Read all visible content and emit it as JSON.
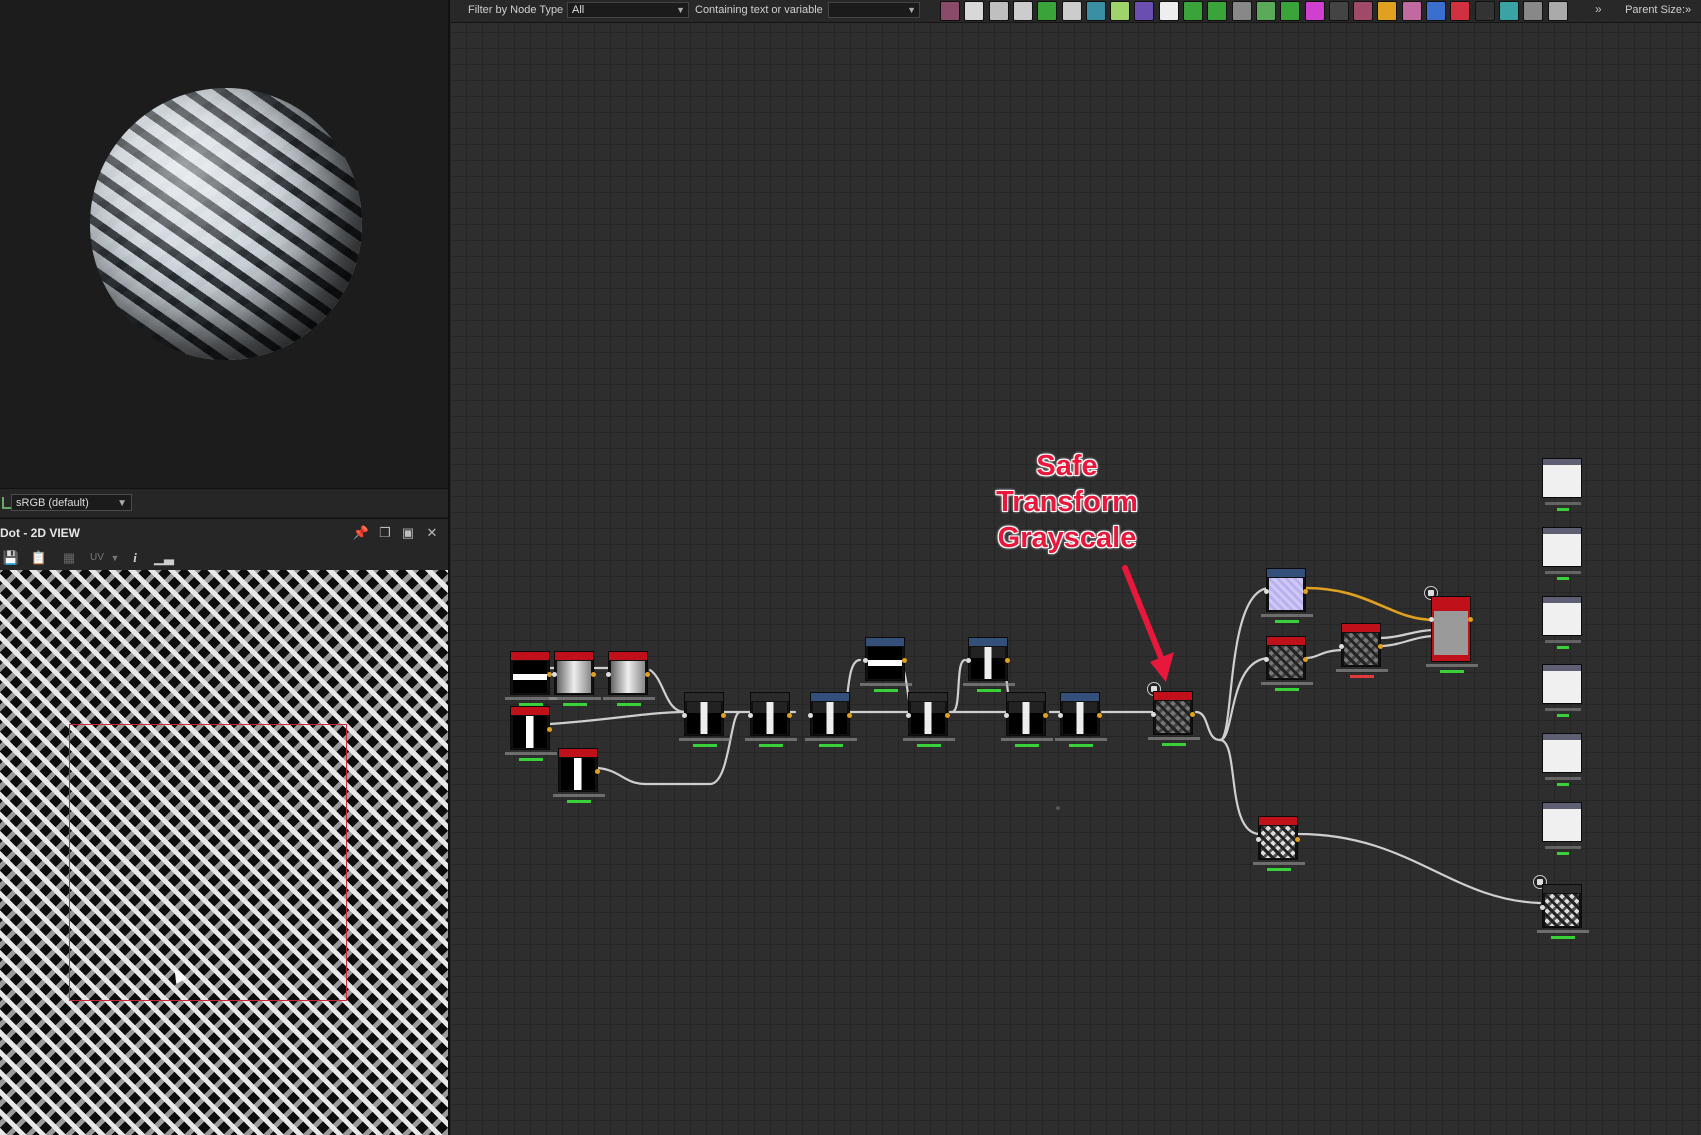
{
  "view3d": {
    "title": ""
  },
  "colorspace": {
    "value": "sRGB (default)"
  },
  "view2d": {
    "title": "Dot - 2D VIEW",
    "uv_label": "UV",
    "info_label": "i"
  },
  "filter_bar": {
    "filter_label": "Filter by Node Type",
    "filter_value": "All",
    "text_label": "Containing text or variable",
    "text_value": "",
    "parent_size_label": "Parent Size:"
  },
  "toolbar_icons": [
    {
      "name": "bitmap-node-icon",
      "color": "#8a4a6a"
    },
    {
      "name": "svg-node-icon",
      "color": "#d8d8d8"
    },
    {
      "name": "color-node-icon",
      "color": "#bfbfbf"
    },
    {
      "name": "transform-node-icon",
      "color": "#cccccc"
    },
    {
      "name": "curve-node-icon",
      "color": "#3aa43a"
    },
    {
      "name": "levels-node-icon",
      "color": "#cccccc"
    },
    {
      "name": "warp-node-icon",
      "color": "#3a8fa4"
    },
    {
      "name": "gradient-node-icon",
      "color": "#9fd46a"
    },
    {
      "name": "blend-node-icon",
      "color": "#6a4fb0"
    },
    {
      "name": "tile-node-icon",
      "color": "#eeeeee"
    },
    {
      "name": "distance-node-icon",
      "color": "#3aa43a"
    },
    {
      "name": "fx-node-icon",
      "color": "#3aa43a"
    },
    {
      "name": "emboss-node-icon",
      "color": "#888888"
    },
    {
      "name": "hsl-node-icon",
      "color": "#5aaa5a"
    },
    {
      "name": "histogram-node-icon",
      "color": "#3aa43a"
    },
    {
      "name": "rgba-node-icon",
      "color": "#d040d0"
    },
    {
      "name": "noise-node-icon",
      "color": "#444444"
    },
    {
      "name": "pixel-node-icon",
      "color": "#a04a6a"
    },
    {
      "name": "warning-node-icon",
      "color": "#e0a020"
    },
    {
      "name": "text-node-icon",
      "color": "#c06aa0"
    },
    {
      "name": "shape-node-icon",
      "color": "#3a6fd0"
    },
    {
      "name": "fill-node-icon",
      "color": "#d03040"
    },
    {
      "name": "value-node-icon",
      "color": "#333333"
    },
    {
      "name": "normal-node-icon",
      "color": "#3aa4a4"
    },
    {
      "name": "input-node-icon",
      "color": "#888888"
    },
    {
      "name": "output-node-icon",
      "color": "#aaaaaa"
    }
  ],
  "annotation": {
    "line1": "Safe",
    "line2": "Transform",
    "line3": "Grayscale"
  },
  "colors": {
    "accent_red": "#e8173c",
    "node_header_red": "#c0101a",
    "node_header_blue": "#34507a",
    "orange_wire": "#e0a020"
  }
}
